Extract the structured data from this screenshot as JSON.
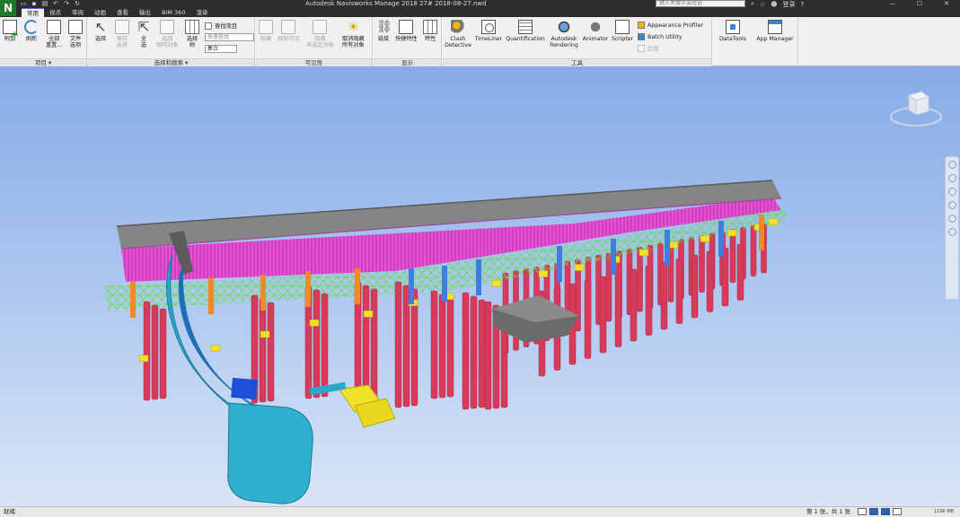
{
  "app": {
    "logo": "N",
    "window_title": "Autodesk Navisworks Manage 2018     27# 2018-08-27.nwd",
    "search_placeholder": "键入关键字或短语",
    "sign_in": "登录",
    "help": "?",
    "window_controls": [
      "—",
      "☐",
      "✕"
    ]
  },
  "quick_access": [
    "open-icon",
    "save-icon",
    "print-icon",
    "undo-icon",
    "redo-icon",
    "refresh-icon"
  ],
  "ribbon_tabs": [
    {
      "label": "常用",
      "active": true
    },
    {
      "label": "视点",
      "active": false
    },
    {
      "label": "审阅",
      "active": false
    },
    {
      "label": "动画",
      "active": false
    },
    {
      "label": "查看",
      "active": false
    },
    {
      "label": "输出",
      "active": false
    },
    {
      "label": "BIM 360",
      "active": false
    },
    {
      "label": "渲染",
      "active": false
    }
  ],
  "panels": {
    "project": {
      "title": "项目 ▾",
      "buttons": [
        {
          "label": "附加",
          "disabled": false
        },
        {
          "label": "刷新",
          "disabled": false
        },
        {
          "label": "全部\n重置...",
          "disabled": false
        },
        {
          "label": "文件\n选项",
          "disabled": false
        }
      ]
    },
    "select_search": {
      "title": "选择和搜索 ▾",
      "buttons": [
        {
          "label": "选择",
          "disabled": false
        },
        {
          "label": "保存\n选择",
          "disabled": true
        },
        {
          "label": "全\n选",
          "disabled": false
        },
        {
          "label": "选择\n相同对象",
          "disabled": true
        },
        {
          "label": "选择\n树",
          "disabled": false
        }
      ],
      "find_items_label": "查找项目",
      "quick_find_placeholder": "快速查找",
      "sets_label": "集合"
    },
    "visibility": {
      "title": "可见性",
      "buttons": [
        {
          "label": "隐藏",
          "disabled": true
        },
        {
          "label": "强制可见",
          "disabled": true
        },
        {
          "label": "隐藏\n未选定对象",
          "disabled": true
        },
        {
          "label": "取消隐藏\n所有对象",
          "disabled": false
        }
      ]
    },
    "display": {
      "title": "显示",
      "buttons": [
        {
          "label": "链接",
          "disabled": false
        },
        {
          "label": "快捷特性",
          "disabled": false
        },
        {
          "label": "特性",
          "disabled": false
        }
      ]
    },
    "tools": {
      "title": "工具",
      "buttons": [
        {
          "label": "Clash\nDetective",
          "disabled": false
        },
        {
          "label": "TimeLiner",
          "disabled": false
        },
        {
          "label": "Quantification",
          "disabled": false
        },
        {
          "label": "Autodesk\nRendering",
          "disabled": false
        },
        {
          "label": "Animator",
          "disabled": false
        },
        {
          "label": "Scripter",
          "disabled": false
        }
      ],
      "small": [
        {
          "label": "Appearance Profiler",
          "disabled": false
        },
        {
          "label": "Batch Utility",
          "disabled": false
        },
        {
          "label": "比较",
          "disabled": true
        }
      ]
    },
    "extras": {
      "buttons": [
        {
          "label": "DataTools",
          "disabled": false
        },
        {
          "label": "App Manager",
          "disabled": false
        }
      ]
    }
  },
  "statusbar": {
    "status": "就绪",
    "sheet": "第 1 张，共 1 张",
    "memory": "1196 MB"
  },
  "colors": {
    "deck_gray": "#858585",
    "rebar_magenta": "#e040c8",
    "pile_red": "#d83a5a",
    "cap_yellow": "#f0e22a",
    "bracing_green": "#6ee04e",
    "column_blue": "#3f7de0",
    "column_orange": "#f08a24",
    "tunnel_teal": "#2aa7c9"
  }
}
